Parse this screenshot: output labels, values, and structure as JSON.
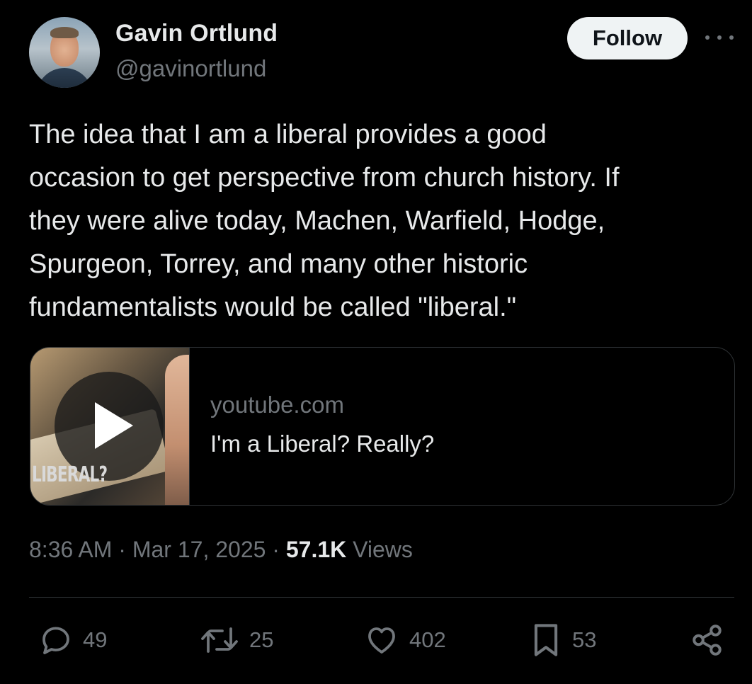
{
  "author": {
    "name": "Gavin Ortlund",
    "handle": "@gavinortlund"
  },
  "follow_label": "Follow",
  "tweet": {
    "text": "The idea that I am a liberal provides a good\noccasion to get perspective from church history. If\nthey were alive today, Machen, Warfield, Hodge,\nSpurgeon, Torrey, and many other historic\nfundamentalists would be called \"liberal.\""
  },
  "card": {
    "thumbnail_text": "LIBERAL?",
    "domain": "youtube.com",
    "title": "I'm a Liberal? Really?"
  },
  "meta": {
    "time": "8:36 AM",
    "separator": " · ",
    "date": "Mar 17, 2025",
    "views_count": "57.1K",
    "views_label": " Views"
  },
  "actions": {
    "replies": "49",
    "reposts": "25",
    "likes": "402",
    "bookmarks": "53"
  },
  "colors": {
    "background": "#000000",
    "text": "#e7e9ea",
    "secondary": "#71767b",
    "border": "#2f3336"
  }
}
